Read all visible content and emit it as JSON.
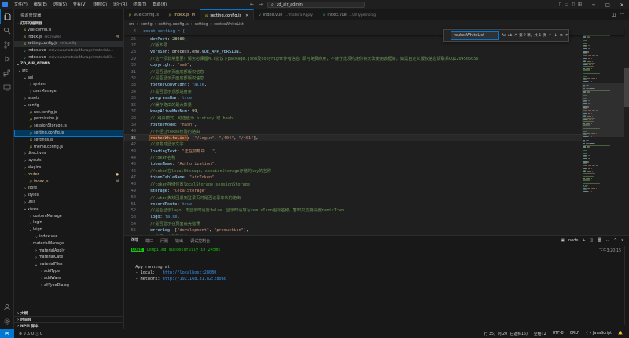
{
  "window": {
    "menu": [
      "文件(F)",
      "编辑(E)",
      "选择(S)",
      "查看(V)",
      "转到(G)",
      "运行(R)",
      "终端(T)",
      "帮助(H)"
    ],
    "command_center": "zd_air_admin"
  },
  "sidebar": {
    "title": "资源管理器",
    "open_editors": {
      "header": "打开的编辑器",
      "items": [
        {
          "name": "vue.config.js",
          "desc": "",
          "type": "js",
          "badge": ""
        },
        {
          "name": "index.js",
          "desc": "src\\router",
          "type": "js",
          "badge": "M"
        },
        {
          "name": "setting.config.js",
          "desc": "src\\config",
          "type": "js",
          "badge": ""
        },
        {
          "name": "index.vue",
          "desc": "src\\views\\materialManage\\materialA...",
          "type": "vue",
          "badge": ""
        },
        {
          "name": "index.vue",
          "desc": "src\\views\\materialManage\\materialFil...",
          "type": "vue",
          "badge": ""
        }
      ]
    },
    "project": {
      "header": "ZD_AIR_ADMIN",
      "tree": [
        {
          "label": "src",
          "depth": 0,
          "kind": "folder-open"
        },
        {
          "label": "api",
          "depth": 1,
          "kind": "folder-open"
        },
        {
          "label": "system",
          "depth": 2,
          "kind": "folder"
        },
        {
          "label": "userManage",
          "depth": 2,
          "kind": "folder"
        },
        {
          "label": "assets",
          "depth": 1,
          "kind": "folder"
        },
        {
          "label": "config",
          "depth": 1,
          "kind": "folder-open"
        },
        {
          "label": "net.config.js",
          "depth": 2,
          "kind": "js"
        },
        {
          "label": "permission.js",
          "depth": 2,
          "kind": "js"
        },
        {
          "label": "sessionStorage.js",
          "depth": 2,
          "kind": "js"
        },
        {
          "label": "setting.config.js",
          "depth": 2,
          "kind": "js",
          "selected": true
        },
        {
          "label": "settings.js",
          "depth": 2,
          "kind": "js"
        },
        {
          "label": "theme.config.js",
          "depth": 2,
          "kind": "js"
        },
        {
          "label": "directives",
          "depth": 1,
          "kind": "folder"
        },
        {
          "label": "layouts",
          "depth": 1,
          "kind": "folder"
        },
        {
          "label": "plugins",
          "depth": 1,
          "kind": "folder"
        },
        {
          "label": "router",
          "depth": 1,
          "kind": "folder-open",
          "modified": true
        },
        {
          "label": "index.js",
          "depth": 2,
          "kind": "js",
          "badge": "M"
        },
        {
          "label": "store",
          "depth": 1,
          "kind": "folder"
        },
        {
          "label": "styles",
          "depth": 1,
          "kind": "folder"
        },
        {
          "label": "utils",
          "depth": 1,
          "kind": "folder"
        },
        {
          "label": "views",
          "depth": 1,
          "kind": "folder-open"
        },
        {
          "label": "customManage",
          "depth": 2,
          "kind": "folder"
        },
        {
          "label": "login",
          "depth": 2,
          "kind": "folder"
        },
        {
          "label": "loign",
          "depth": 2,
          "kind": "folder-open"
        },
        {
          "label": "index.vue",
          "depth": 3,
          "kind": "vue"
        },
        {
          "label": "materialManage",
          "depth": 2,
          "kind": "folder-open"
        },
        {
          "label": "materialApply",
          "depth": 3,
          "kind": "folder"
        },
        {
          "label": "materialCate",
          "depth": 3,
          "kind": "folder"
        },
        {
          "label": "materialFiles",
          "depth": 3,
          "kind": "folder-open"
        },
        {
          "label": "addType",
          "depth": 4,
          "kind": "folder"
        },
        {
          "label": "addWare",
          "depth": 4,
          "kind": "folder"
        },
        {
          "label": "allTypeDialog",
          "depth": 4,
          "kind": "folder"
        }
      ]
    },
    "bottom_sections": [
      "大纲",
      "时间线",
      "NPM 脚本"
    ]
  },
  "tabs": [
    {
      "label": "vue.config.js",
      "desc": "",
      "badge": "",
      "active": false,
      "type": "js"
    },
    {
      "label": "index.js",
      "desc": "",
      "badge": "M",
      "active": false,
      "type": "js"
    },
    {
      "label": "setting.config.js",
      "desc": "",
      "badge": "",
      "active": true,
      "type": "js"
    },
    {
      "label": "index.vue",
      "desc": "...\\materialApply",
      "badge": "",
      "active": false,
      "type": "vue"
    },
    {
      "label": "index.vue",
      "desc": "...\\allTypeDialog",
      "badge": "",
      "active": false,
      "type": "vue"
    }
  ],
  "breadcrumb": [
    "src",
    "config",
    "setting.config.js",
    "setting",
    "routesWhiteList"
  ],
  "sticky_line": {
    "num": "4",
    "text": "const setting = {"
  },
  "code_lines": [
    {
      "num": "26",
      "parts": [
        [
          "p",
          "devPort"
        ],
        [
          "b",
          ": "
        ],
        [
          "n",
          "28080"
        ],
        [
          "b",
          ","
        ]
      ]
    },
    {
      "num": "27",
      "parts": [
        [
          "cm",
          "//版本号"
        ]
      ]
    },
    {
      "num": "28",
      "parts": [
        [
          "p",
          "version"
        ],
        [
          "b",
          ": process.env."
        ],
        [
          "p",
          "VUE_APP_VERSION"
        ],
        [
          "b",
          ","
        ]
      ]
    },
    {
      "num": "29",
      "parts": [
        [
          "cm",
          "//这一项非常重要！请务必保留MIT协议下package.json及copyright作者信息 即可免费商用，不遵守此项约定你将无法使用该框架，如需自定义版权信息请联系QQ1204505056"
        ]
      ]
    },
    {
      "num": "30",
      "parts": [
        [
          "p",
          "copyright"
        ],
        [
          "b",
          ": "
        ],
        [
          "s",
          "\"vab\""
        ],
        [
          "b",
          ","
        ]
      ]
    },
    {
      "num": "31",
      "parts": [
        [
          "cm",
          "//是否显示页面底部版权信息"
        ]
      ]
    },
    {
      "num": "32",
      "parts": [
        [
          "cm",
          "//是否显示页面底部版权信息"
        ]
      ]
    },
    {
      "num": "33",
      "parts": [
        [
          "p",
          "footerCopyright"
        ],
        [
          "b",
          ": "
        ],
        [
          "k",
          "false"
        ],
        [
          "b",
          ","
        ]
      ]
    },
    {
      "num": "34",
      "parts": [
        [
          "cm",
          "//是否显示顶部进度条"
        ]
      ]
    },
    {
      "num": "35",
      "parts": [
        [
          "p",
          "progressBar"
        ],
        [
          "b",
          ": "
        ],
        [
          "k",
          "true"
        ],
        [
          "b",
          ","
        ]
      ]
    },
    {
      "num": "36",
      "parts": [
        [
          "cm",
          "//缓存路由的最大数量"
        ]
      ]
    },
    {
      "num": "37",
      "parts": [
        [
          "p",
          "keepAliveMaxNum"
        ],
        [
          "b",
          ": "
        ],
        [
          "n",
          "99"
        ],
        [
          "b",
          ","
        ]
      ]
    },
    {
      "num": "38",
      "parts": [
        [
          "cm",
          "// 路由模式，可选值为 history 或 hash"
        ]
      ]
    },
    {
      "num": "39",
      "parts": [
        [
          "p",
          "routerMode"
        ],
        [
          "b",
          ": "
        ],
        [
          "s",
          "\"hash\""
        ],
        [
          "b",
          ","
        ]
      ]
    },
    {
      "num": "40",
      "parts": [
        [
          "cm",
          "//不经过token校验的路由"
        ]
      ]
    },
    {
      "num": "35",
      "current": true,
      "parts": [
        [
          "hl",
          "routesWhiteList"
        ],
        [
          "b",
          ": ["
        ],
        [
          "s",
          "\"/login\""
        ],
        [
          "b",
          ", "
        ],
        [
          "s",
          "\"/404\""
        ],
        [
          "b",
          ", "
        ],
        [
          "s",
          "\"/401\""
        ],
        [
          "b",
          "],"
        ]
      ]
    },
    {
      "num": "42",
      "parts": [
        [
          "cm",
          "//加载时显示文字"
        ]
      ]
    },
    {
      "num": "43",
      "parts": [
        [
          "p",
          "loadingText"
        ],
        [
          "b",
          ": "
        ],
        [
          "s",
          "\"正在加载中...\""
        ],
        [
          "b",
          ","
        ]
      ]
    },
    {
      "num": "44",
      "parts": [
        [
          "cm",
          "//token名称"
        ]
      ]
    },
    {
      "num": "45",
      "parts": [
        [
          "p",
          "tokenName"
        ],
        [
          "b",
          ": "
        ],
        [
          "s",
          "\"Authorization\""
        ],
        [
          "b",
          ","
        ]
      ]
    },
    {
      "num": "46",
      "parts": [
        [
          "cm",
          "//token在localStorage、sessionStorage存储的key的名称"
        ]
      ]
    },
    {
      "num": "47",
      "parts": [
        [
          "p",
          "tokenTableName"
        ],
        [
          "b",
          ": "
        ],
        [
          "s",
          "\"airToken\""
        ],
        [
          "b",
          ","
        ]
      ]
    },
    {
      "num": "48",
      "parts": [
        [
          "cm",
          "//token存储位置localStorage sessionStorage"
        ]
      ]
    },
    {
      "num": "49",
      "parts": [
        [
          "p",
          "storage"
        ],
        [
          "b",
          ": "
        ],
        [
          "s",
          "\"localStorage\""
        ],
        [
          "b",
          ","
        ]
      ]
    },
    {
      "num": "50",
      "parts": [
        [
          "cm",
          "//token失效回退到登录页时是否记录本次的路由"
        ]
      ]
    },
    {
      "num": "51",
      "parts": [
        [
          "p",
          "recordRoute"
        ],
        [
          "b",
          ": "
        ],
        [
          "k",
          "true"
        ],
        [
          "b",
          ","
        ]
      ]
    },
    {
      "num": "52",
      "parts": [
        [
          "cm",
          "//是否显示logo，不显示时设置false，显示时请填写remixIcon图标名称，暂时只支持设置remixIcon"
        ]
      ]
    },
    {
      "num": "53",
      "parts": [
        [
          "p",
          "logo"
        ],
        [
          "b",
          ": "
        ],
        [
          "k",
          "false"
        ],
        [
          "b",
          ","
        ]
      ]
    },
    {
      "num": "54",
      "parts": [
        [
          "cm",
          "//是否显示在页面高亮错误"
        ]
      ]
    },
    {
      "num": "55",
      "parts": [
        [
          "p",
          "errorLog"
        ],
        [
          "b",
          ": ["
        ],
        [
          "s",
          "\"development\""
        ],
        [
          "b",
          ", "
        ],
        [
          "s",
          "\"production\""
        ],
        [
          "b",
          "],"
        ]
      ]
    },
    {
      "num": "56",
      "parts": [
        [
          "cm",
          "//是否开启登录拦截"
        ]
      ]
    },
    {
      "num": "57",
      "parts": [
        [
          "p",
          "loginInterception"
        ],
        [
          "b",
          ": "
        ],
        [
          "k",
          "true"
        ],
        [
          "b",
          ","
        ]
      ]
    }
  ],
  "find_widget": {
    "value": "routesWhiteList",
    "options": [
      "Aa",
      "ab",
      ".*"
    ],
    "count": "第 ? 项，共 1 项"
  },
  "panel": {
    "tabs": [
      "终端",
      "端口",
      "问题",
      "输出",
      "调试控制台"
    ],
    "active_tab": "终端",
    "shell": "node",
    "time": "下午3:20:15",
    "lines": [
      {
        "type": "done",
        "badge": "DONE",
        "text": "Compiled successfully in 245ms"
      },
      {
        "type": "blank",
        "text": ""
      },
      {
        "type": "blank",
        "text": ""
      },
      {
        "type": "plain",
        "text": "  App running at:"
      },
      {
        "type": "url",
        "label": "  - Local:   ",
        "url": "http://localhost:28080"
      },
      {
        "type": "url",
        "label": "  - Network: ",
        "url": "http://192.168.31.82:28080"
      }
    ]
  },
  "statusbar": {
    "errors": "0",
    "warnings": "0",
    "infos": "0",
    "position": "行 35，列 20 (已选择15)",
    "spaces": "空格: 2",
    "encoding": "UTF-8",
    "eol": "CRLF",
    "language": "JavaScript"
  },
  "colors": {
    "accent": "#0078d4",
    "selection": "#04395e",
    "find_highlight": "#613214",
    "done_badge": "#16c60c"
  }
}
